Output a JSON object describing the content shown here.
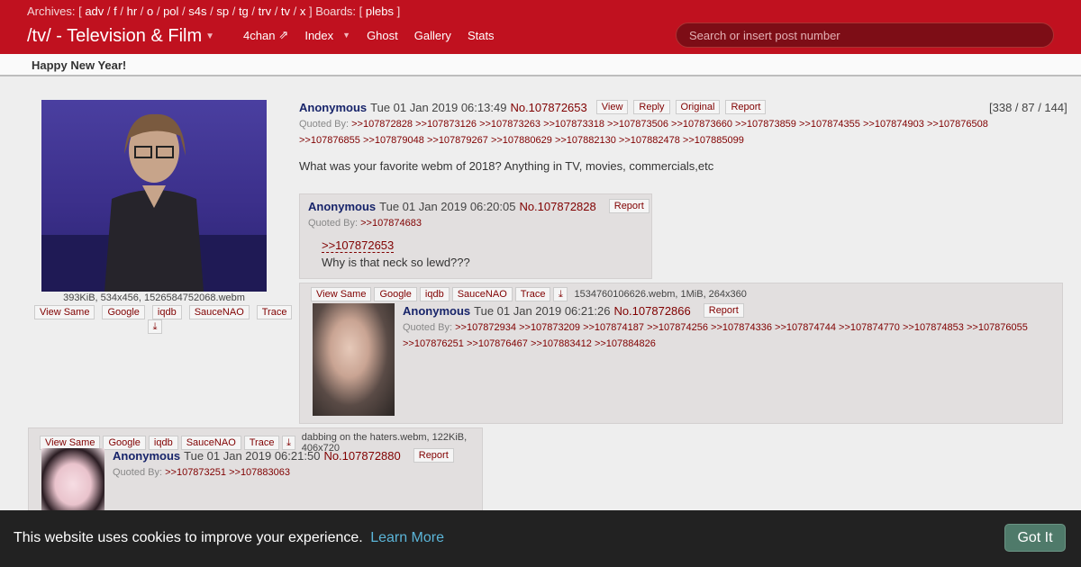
{
  "header": {
    "archives_label": "Archives:",
    "archives": [
      "adv",
      "f",
      "hr",
      "o",
      "pol",
      "s4s",
      "sp",
      "tg",
      "trv",
      "tv",
      "x"
    ],
    "boards_label": "Boards:",
    "boards": [
      "plebs"
    ],
    "board_title": "/tv/ - Television & Film",
    "nav": [
      "4chan",
      "Index",
      "Ghost",
      "Gallery",
      "Stats"
    ],
    "search_placeholder": "Search or insert post number"
  },
  "announcement": "Happy New Year!",
  "op": {
    "fileinfo": "393KiB, 534x456, 1526584752068.webm",
    "file_buttons": [
      "View Same",
      "Google",
      "iqdb",
      "SauceNAO",
      "Trace"
    ],
    "name": "Anonymous",
    "date": "Tue 01 Jan 2019 06:13:49",
    "number": "No.107872653",
    "actions": [
      "View",
      "Reply",
      "Original",
      "Report"
    ],
    "counts": "[338 / 87 / 144]",
    "quoted_label": "Quoted By:",
    "quoted_by": [
      ">>107872828",
      ">>107873126",
      ">>107873263",
      ">>107873318",
      ">>107873506",
      ">>107873660",
      ">>107873859",
      ">>107874355",
      ">>107874903",
      ">>107876508",
      ">>107876855",
      ">>107879048",
      ">>107879267",
      ">>107880629",
      ">>107882130",
      ">>107882478",
      ">>107885099"
    ],
    "text": "What was your favorite webm of 2018? Anything in TV, movies, commercials,etc"
  },
  "replies": [
    {
      "name": "Anonymous",
      "date": "Tue 01 Jan 2019 06:20:05",
      "number": "No.107872828",
      "action": "Report",
      "quoted_label": "Quoted By:",
      "quoted_by": [
        ">>107874683"
      ],
      "quotelink": ">>107872653",
      "text": "Why is that neck so lewd???"
    },
    {
      "file_buttons": [
        "View Same",
        "Google",
        "iqdb",
        "SauceNAO",
        "Trace"
      ],
      "fileinfo": "1534760106626.webm, 1MiB, 264x360",
      "name": "Anonymous",
      "date": "Tue 01 Jan 2019 06:21:26",
      "number": "No.107872866",
      "action": "Report",
      "quoted_label": "Quoted By:",
      "quoted_by": [
        ">>107872934",
        ">>107873209",
        ">>107874187",
        ">>107874256",
        ">>107874336",
        ">>107874744",
        ">>107874770",
        ">>107874853",
        ">>107876055",
        ">>107876251",
        ">>107876467",
        ">>107883412",
        ">>107884826"
      ]
    },
    {
      "file_buttons": [
        "View Same",
        "Google",
        "iqdb",
        "SauceNAO",
        "Trace"
      ],
      "fileinfo": "dabbing on the haters.webm, 122KiB, 406x720",
      "name": "Anonymous",
      "date": "Tue 01 Jan 2019 06:21:50",
      "number": "No.107872880",
      "action": "Report",
      "quoted_label": "Quoted By:",
      "quoted_by": [
        ">>107873251",
        ">>107883063"
      ]
    }
  ],
  "cookie": {
    "message": "This website uses cookies to improve your experience.",
    "learn_more": "Learn More",
    "button": "Got It"
  }
}
